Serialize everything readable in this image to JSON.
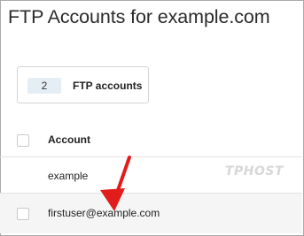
{
  "page": {
    "title": "FTP Accounts for example.com"
  },
  "summary": {
    "count": "2",
    "label": "FTP accounts"
  },
  "table": {
    "header": {
      "account": "Account"
    },
    "rows": [
      {
        "account": "example"
      },
      {
        "account": "firstuser@example.com"
      }
    ]
  },
  "watermark": "TPHOST",
  "annotation": {
    "arrow_color": "#e21b1b"
  }
}
